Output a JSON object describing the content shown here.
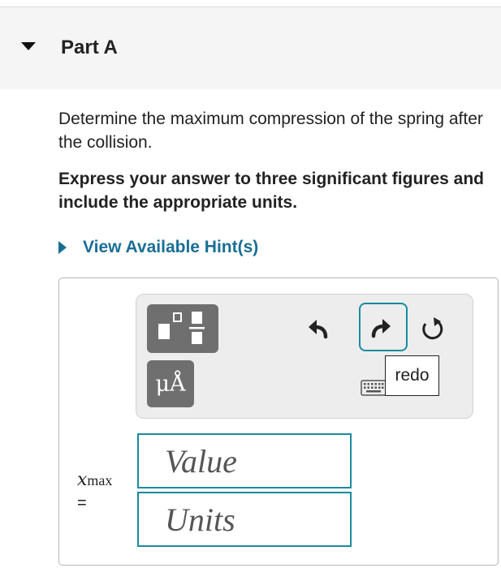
{
  "part": {
    "title": "Part A"
  },
  "question": {
    "text": "Determine the maximum compression of the spring after the collision.",
    "instruction": "Express your answer to three significant figures and include the appropriate units."
  },
  "hint": {
    "label": "View Available Hint(s)"
  },
  "toolbar": {
    "templates_icon": "fraction-templates-icon",
    "units_label": "μÅ",
    "undo_icon": "undo-arrow-icon",
    "redo_icon": "redo-arrow-icon",
    "reset_icon": "reset-circular-arrow-icon",
    "keyboard_icon": "keyboard-icon",
    "tooltip": "redo"
  },
  "answer": {
    "variable": "x",
    "variable_subscript": "max",
    "equals": "=",
    "value_placeholder": "Value",
    "units_placeholder": "Units",
    "accent_color": "#1a8aa0"
  },
  "colors": {
    "link": "#1a6e96",
    "header_bg": "#f5f5f5",
    "button_gray": "#6f6f6f"
  }
}
